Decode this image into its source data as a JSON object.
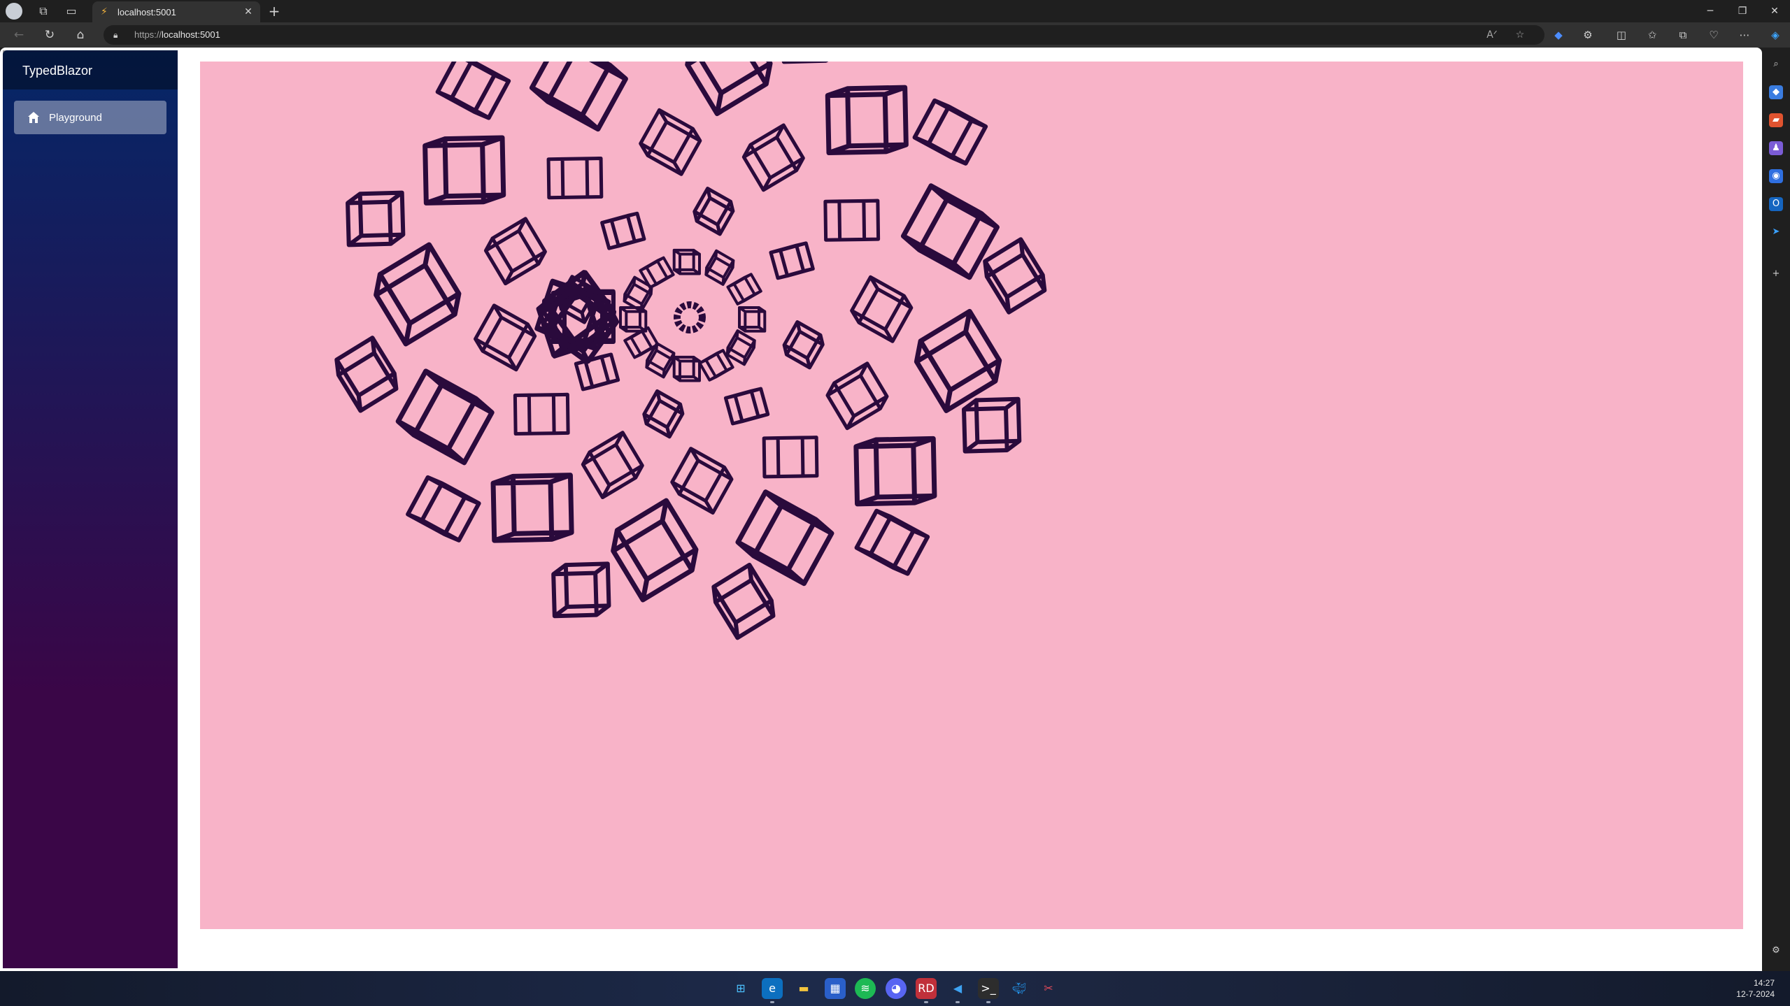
{
  "browser": {
    "tab_title": "localhost:5001",
    "url_scheme": "https://",
    "url_host": "localhost:5001"
  },
  "app": {
    "brand": "TypedBlazor",
    "nav": [
      {
        "label": "Playground",
        "icon": "home-icon",
        "active": true
      }
    ]
  },
  "canvas": {
    "background": "#f8b3c8",
    "stroke_color": "#2a0a3c"
  },
  "taskbar": {
    "time": "14:27",
    "date": "12-7-2024",
    "apps": [
      "start-icon",
      "edge-icon",
      "file-explorer-icon",
      "store-icon",
      "spotify-icon",
      "discord-icon",
      "rider-icon",
      "vscode-icon",
      "terminal-icon",
      "docker-icon",
      "snipping-icon"
    ]
  }
}
